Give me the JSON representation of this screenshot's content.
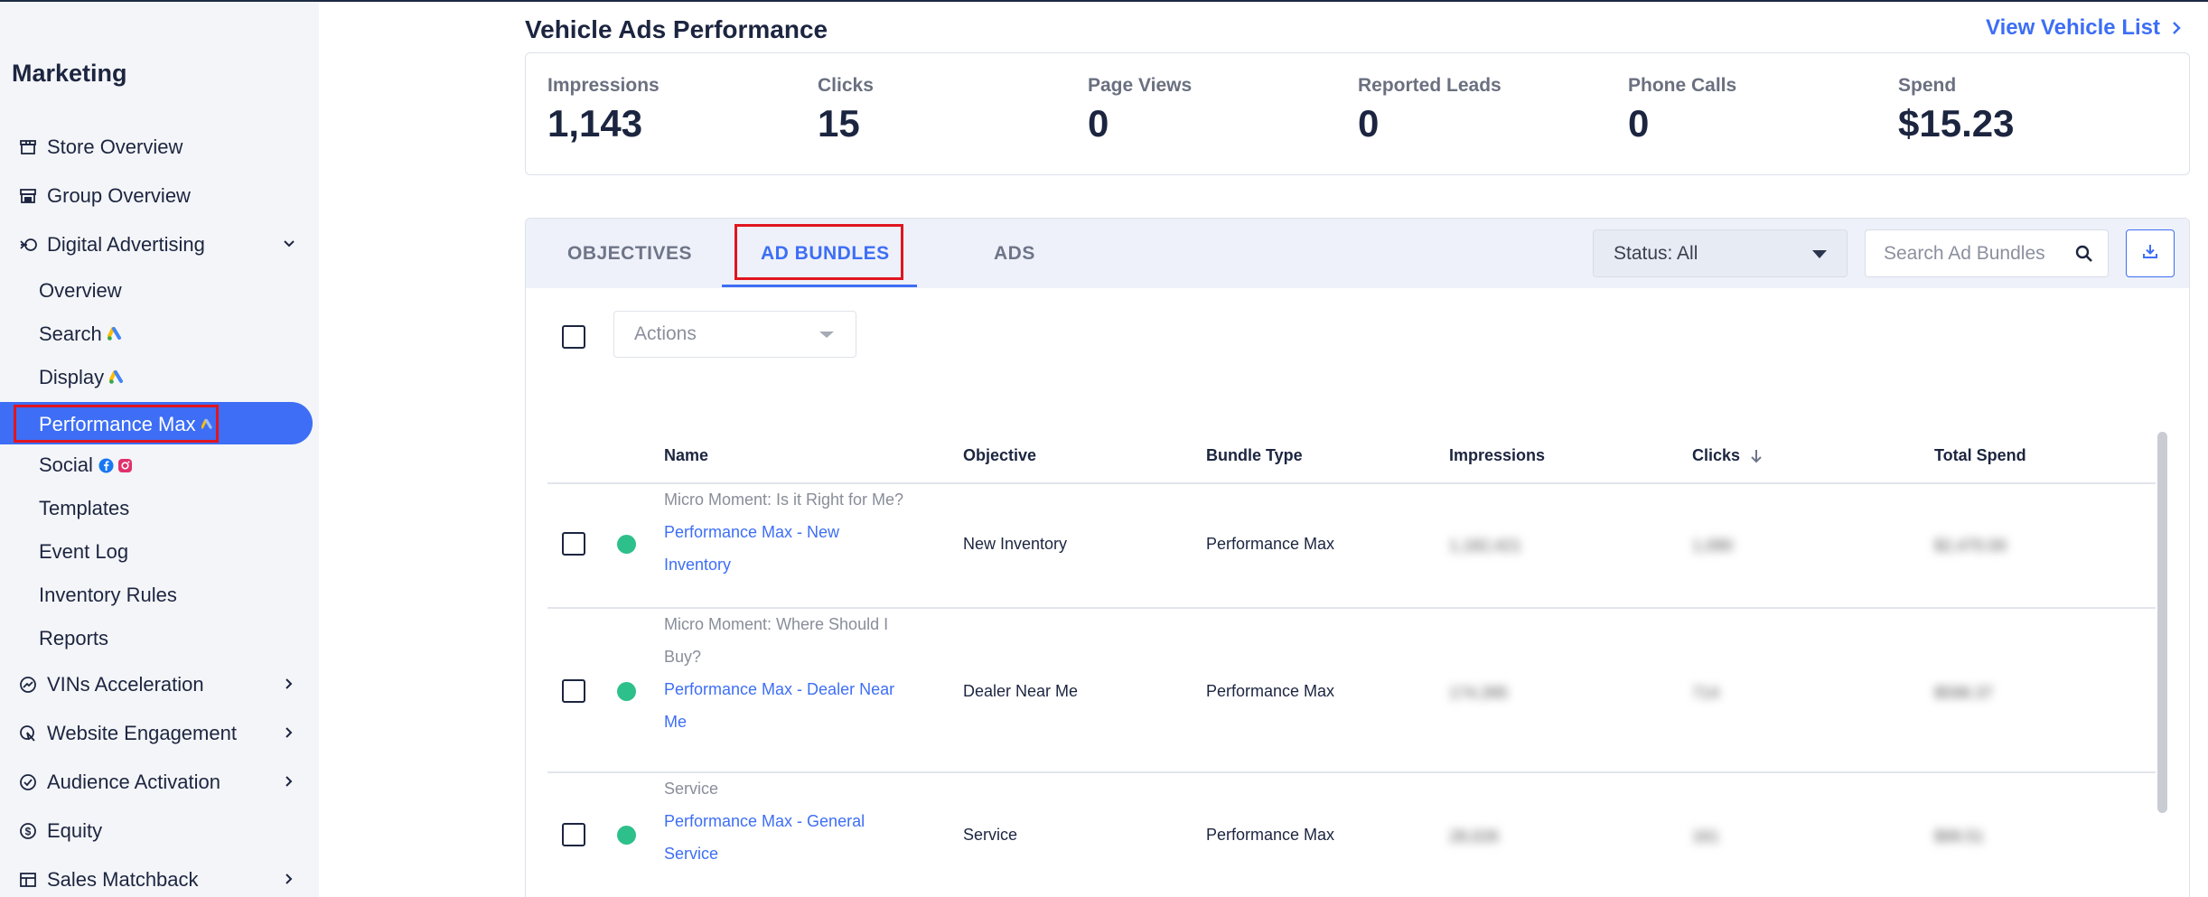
{
  "sidebar": {
    "title": "Marketing",
    "top_items": [
      {
        "label": "Store Overview",
        "icon": "store-icon"
      },
      {
        "label": "Group Overview",
        "icon": "group-store-icon"
      },
      {
        "label": "Digital Advertising",
        "icon": "digital-ads-icon",
        "expanded": true
      }
    ],
    "sub_items": [
      {
        "label": "Overview"
      },
      {
        "label": "Search",
        "badge": "google-ads-icon"
      },
      {
        "label": "Display",
        "badge": "google-ads-icon"
      },
      {
        "label": "Performance Max",
        "badge": "google-ads-icon",
        "active": true
      },
      {
        "label": "Social",
        "badge": "facebook-instagram-icons"
      },
      {
        "label": "Templates"
      },
      {
        "label": "Event Log"
      },
      {
        "label": "Inventory Rules"
      },
      {
        "label": "Reports"
      }
    ],
    "bottom_items": [
      {
        "label": "VINs Acceleration",
        "icon": "vins-icon"
      },
      {
        "label": "Website Engagement",
        "icon": "engagement-icon"
      },
      {
        "label": "Audience Activation",
        "icon": "audience-icon"
      },
      {
        "label": "Equity",
        "icon": "dollar-icon"
      },
      {
        "label": "Sales Matchback",
        "icon": "table-icon"
      }
    ]
  },
  "header": {
    "title": "Vehicle Ads Performance",
    "view_list_label": "View Vehicle List"
  },
  "stats": [
    {
      "label": "Impressions",
      "value": "1,143"
    },
    {
      "label": "Clicks",
      "value": "15"
    },
    {
      "label": "Page Views",
      "value": "0"
    },
    {
      "label": "Reported Leads",
      "value": "0"
    },
    {
      "label": "Phone Calls",
      "value": "0"
    },
    {
      "label": "Spend",
      "value": "$15.23"
    }
  ],
  "tabs": [
    {
      "label": "OBJECTIVES"
    },
    {
      "label": "AD BUNDLES",
      "active": true
    },
    {
      "label": "ADS"
    }
  ],
  "filters": {
    "status_label": "Status: All",
    "search_placeholder": "Search Ad Bundles",
    "actions_label": "Actions"
  },
  "table": {
    "headers": [
      "Name",
      "Objective",
      "Bundle Type",
      "Impressions",
      "Clicks",
      "Total Spend"
    ],
    "sorted_column": "Clicks",
    "sort_direction": "descending",
    "rows": [
      {
        "subtitle": "Micro Moment: Is it Right for Me?",
        "name_lines": [
          "Performance Max - New",
          "Inventory"
        ],
        "objective": "New Inventory",
        "bundle_type": "Performance Max",
        "impressions": "1,182,421",
        "clicks": "1,090",
        "spend": "$2,470.00",
        "status_color": "#2dc08a"
      },
      {
        "subtitle_lines": [
          "Micro Moment: Where Should I",
          "Buy?"
        ],
        "name_lines": [
          "Performance Max - Dealer Near",
          "Me"
        ],
        "objective": "Dealer Near Me",
        "bundle_type": "Performance Max",
        "impressions": "174,395",
        "clicks": "714",
        "spend": "$598.37",
        "status_color": "#2dc08a"
      },
      {
        "subtitle": "Service",
        "name_lines": [
          "Performance Max - General",
          "Service"
        ],
        "objective": "Service",
        "bundle_type": "Performance Max",
        "impressions": "28,026",
        "clicks": "161",
        "spend": "$99.51",
        "status_color": "#2dc08a"
      }
    ]
  },
  "colors": {
    "accent": "#3d6ef5",
    "status_active": "#2dc08a",
    "highlight_box": "#e0151f"
  }
}
